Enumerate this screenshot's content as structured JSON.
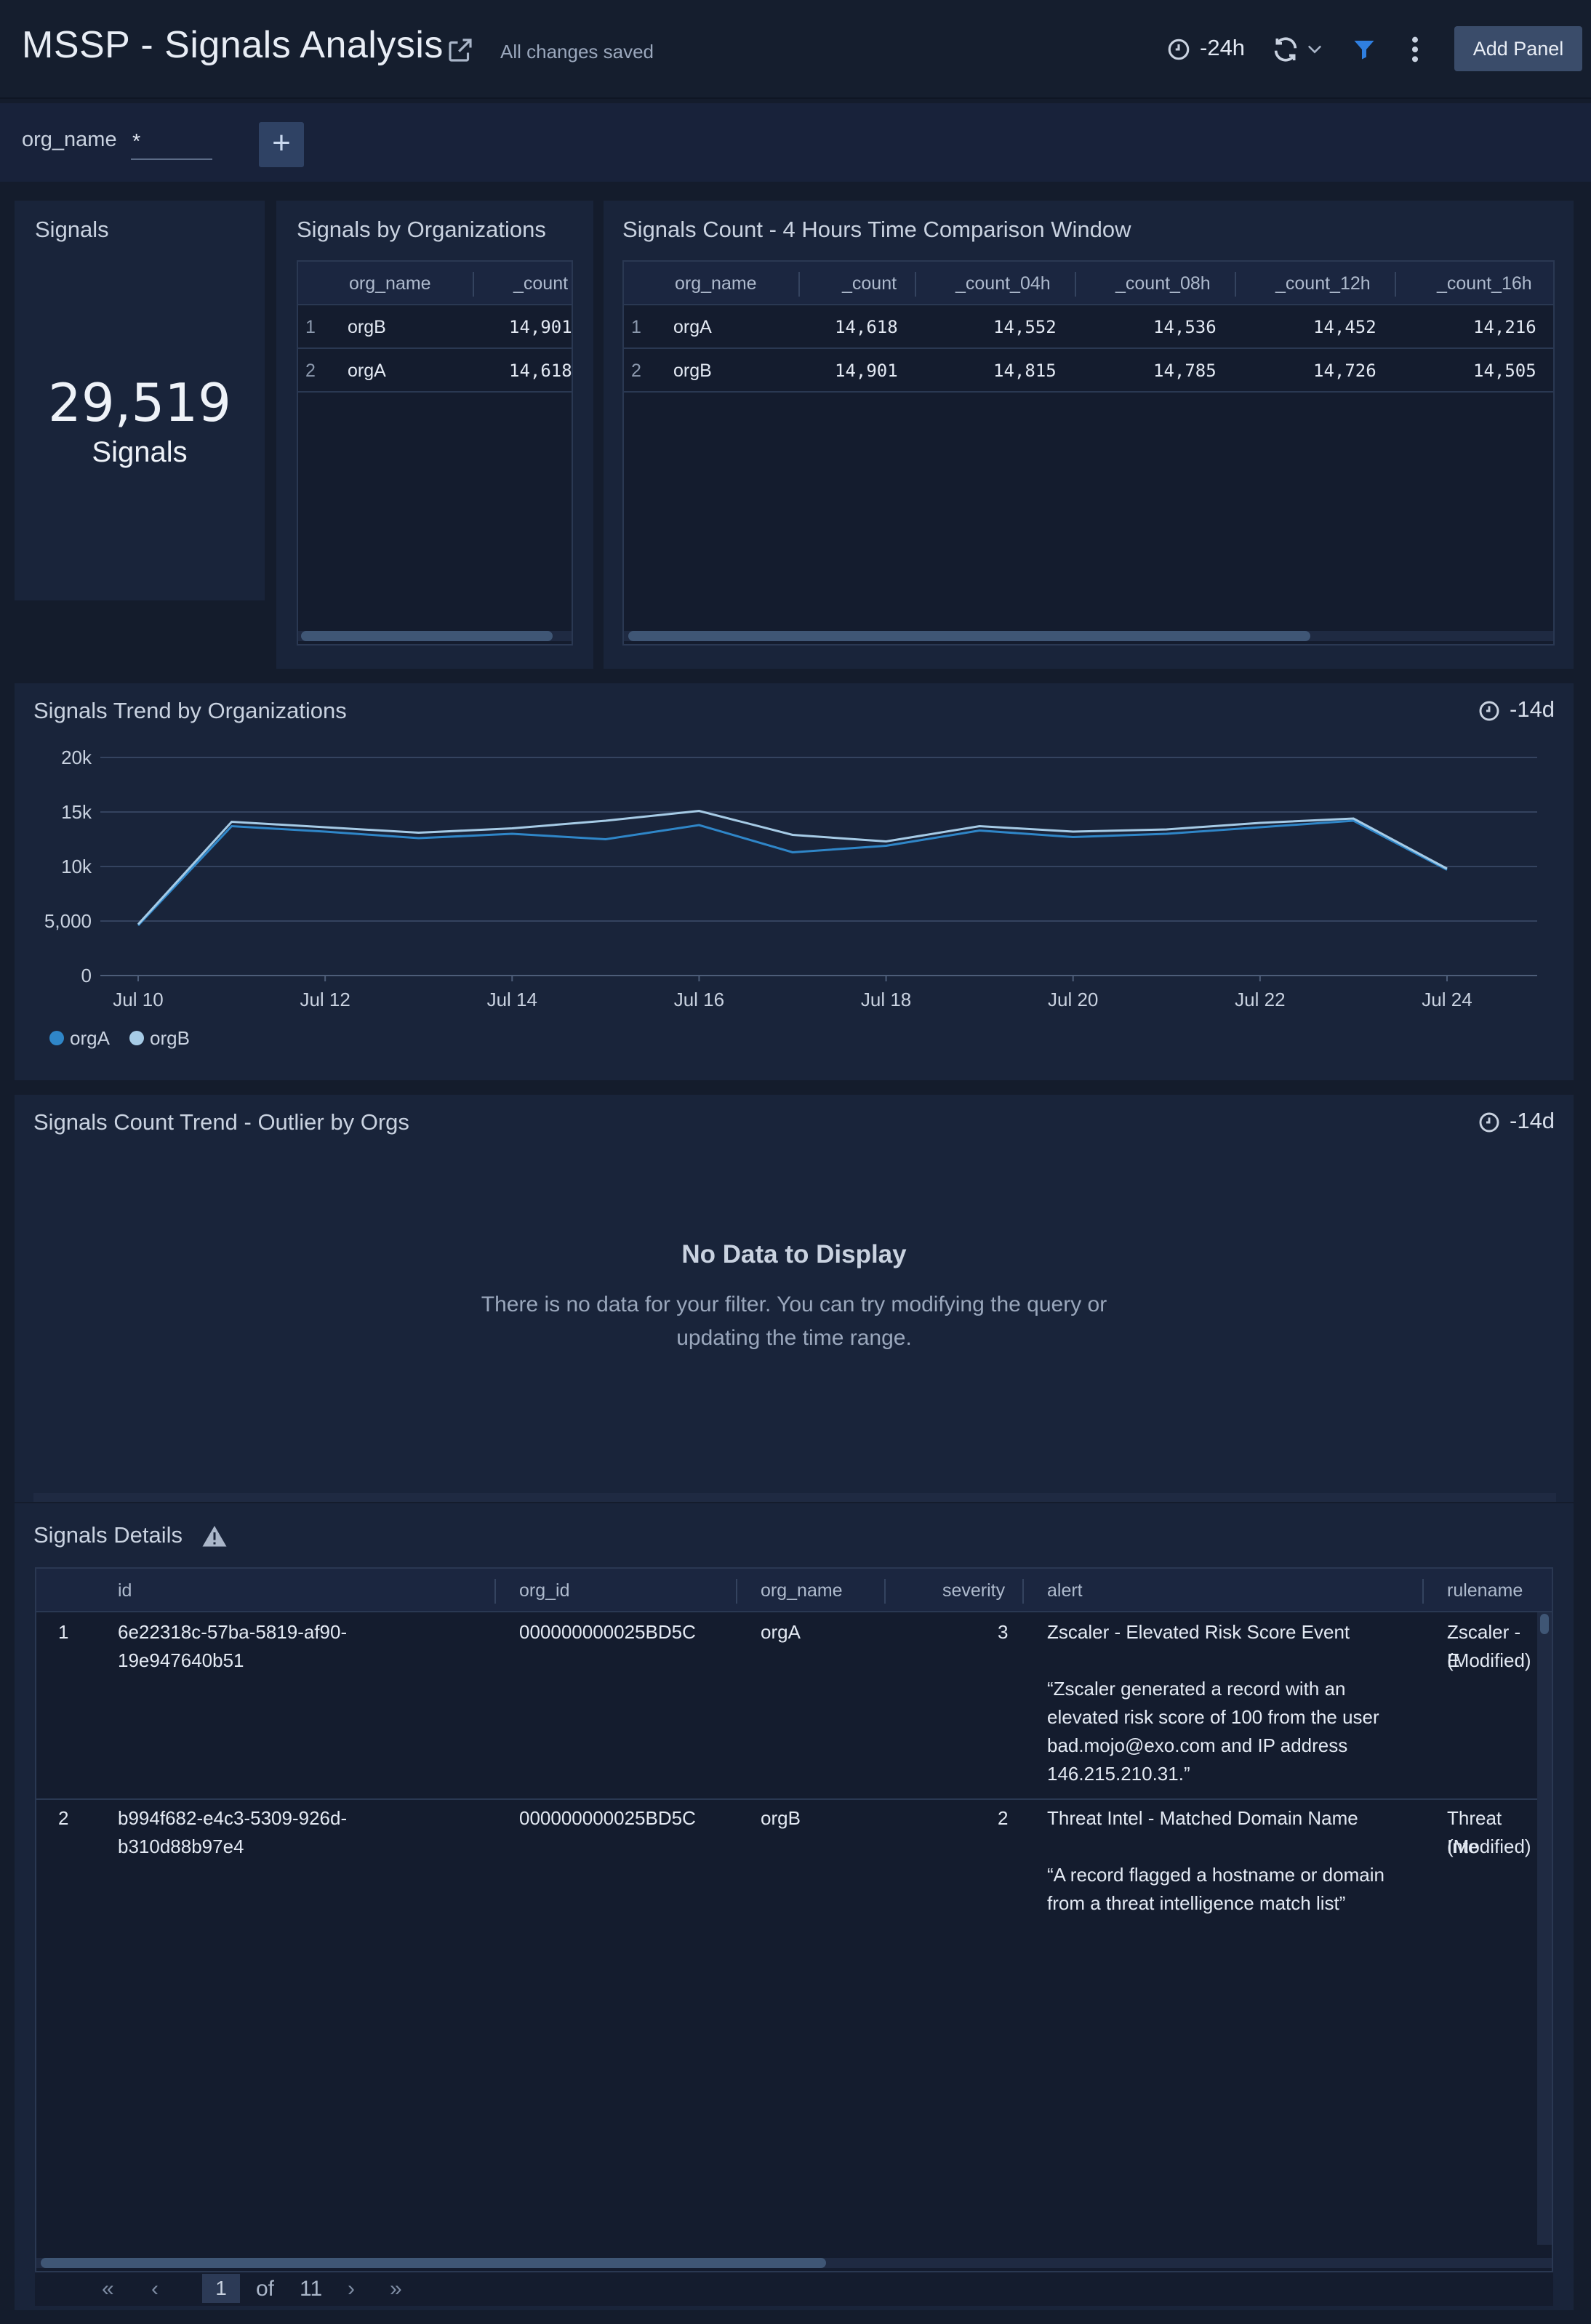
{
  "header": {
    "title": "MSSP - Signals Analysis",
    "saved_status": "All changes saved",
    "time_range": "-24h",
    "add_panel_label": "Add Panel"
  },
  "filters": {
    "label": "org_name",
    "value": "*"
  },
  "panels": {
    "signals": {
      "title": "Signals",
      "value": "29,519",
      "unit": "Signals"
    },
    "by_org": {
      "title": "Signals by Organizations",
      "columns": [
        "org_name",
        "_count"
      ],
      "rows": [
        {
          "idx": "1",
          "org_name": "orgB",
          "count": "14,901"
        },
        {
          "idx": "2",
          "org_name": "orgA",
          "count": "14,618"
        }
      ]
    },
    "compare": {
      "title": "Signals Count - 4 Hours Time Comparison Window",
      "columns": [
        "org_name",
        "_count",
        "_count_04h",
        "_count_08h",
        "_count_12h",
        "_count_16h"
      ],
      "rows": [
        {
          "idx": "1",
          "org_name": "orgA",
          "count": "14,618",
          "c04": "14,552",
          "c08": "14,536",
          "c12": "14,452",
          "c16": "14,216"
        },
        {
          "idx": "2",
          "org_name": "orgB",
          "count": "14,901",
          "c04": "14,815",
          "c08": "14,785",
          "c12": "14,726",
          "c16": "14,505"
        }
      ]
    },
    "trend": {
      "title": "Signals Trend by Organizations",
      "time_range": "-14d"
    },
    "outlier": {
      "title": "Signals Count Trend - Outlier by Orgs",
      "time_range": "-14d",
      "empty_title": "No Data to Display",
      "empty_message": "There is no data for your filter. You can try modifying the query or updating the time range."
    },
    "details": {
      "title": "Signals Details",
      "columns": [
        "id",
        "org_id",
        "org_name",
        "severity",
        "alert",
        "rulename"
      ],
      "rows": [
        {
          "idx": "1",
          "id_l1": "6e22318c-57ba-5819-af90-",
          "id_l2": "19e947640b51",
          "org_id": "000000000025BD5C",
          "org_name": "orgA",
          "severity": "3",
          "alert_title": "Zscaler - Elevated Risk Score Event",
          "alert_l1": "“Zscaler generated a record with an",
          "alert_l2": "elevated risk score of 100 from the user",
          "alert_l3": "bad.mojo@exo.com and IP address",
          "alert_l4": "146.215.210.31.”",
          "rule_l1": "Zscaler - E",
          "rule_l2": "(Modified)"
        },
        {
          "idx": "2",
          "id_l1": "b994f682-e4c3-5309-926d-",
          "id_l2": "b310d88b97e4",
          "org_id": "000000000025BD5C",
          "org_name": "orgB",
          "severity": "2",
          "alert_title": "Threat Intel - Matched Domain Name",
          "alert_l1": "“A record flagged a hostname or domain",
          "alert_l2": "from a threat intelligence match list”",
          "rule_l1": "Threat Inte",
          "rule_l2": "(Modified)"
        }
      ],
      "pager": {
        "current": "1",
        "of_label": "of",
        "total": "11"
      }
    }
  },
  "colors": {
    "orgA": "#2f86c8",
    "orgB": "#a6cbe6",
    "background": "#141c2c",
    "panel": "#19243a"
  },
  "chart_data": {
    "type": "line",
    "title": "Signals Trend by Organizations",
    "x": [
      "Jul 10",
      "Jul 11",
      "Jul 12",
      "Jul 13",
      "Jul 14",
      "Jul 15",
      "Jul 16",
      "Jul 17",
      "Jul 18",
      "Jul 19",
      "Jul 20",
      "Jul 21",
      "Jul 22",
      "Jul 23",
      "Jul 24"
    ],
    "x_tick_labels": [
      "Jul 10",
      "Jul 12",
      "Jul 14",
      "Jul 16",
      "Jul 18",
      "Jul 20",
      "Jul 22",
      "Jul 24"
    ],
    "y_tick_labels": [
      "0",
      "5,000",
      "10k",
      "15k",
      "20k"
    ],
    "ylim": [
      0,
      20000
    ],
    "series": [
      {
        "name": "orgA",
        "values": [
          4600,
          13700,
          13200,
          12600,
          13000,
          12500,
          13800,
          11300,
          11900,
          13300,
          12700,
          13000,
          13600,
          14200,
          9700
        ]
      },
      {
        "name": "orgB",
        "values": [
          4700,
          14100,
          13600,
          13100,
          13500,
          14200,
          15100,
          12900,
          12300,
          13700,
          13200,
          13400,
          14000,
          14400,
          9800
        ]
      }
    ],
    "legend_position": "bottom-left",
    "grid": true
  }
}
